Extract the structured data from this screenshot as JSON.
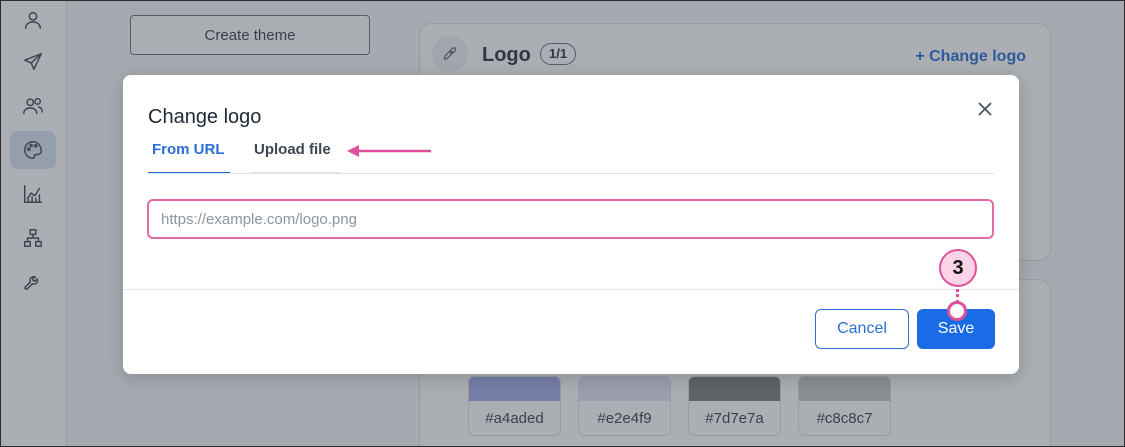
{
  "background": {
    "create_theme_label": "Create theme",
    "logo_card": {
      "title": "Logo",
      "count": "1/1",
      "change_logo_label": "+ Change logo"
    },
    "swatches": [
      {
        "hex": "#a4aded",
        "color": "#a4aded"
      },
      {
        "hex": "#e2e4f9",
        "color": "#e2e4f9"
      },
      {
        "hex": "#7d7e7a",
        "color": "#7d7e7a"
      },
      {
        "hex": "#c8c8c7",
        "color": "#c8c8c7"
      }
    ]
  },
  "sidebar": {
    "items": [
      {
        "icon": "user-icon"
      },
      {
        "icon": "send-icon"
      },
      {
        "icon": "contacts-icon"
      },
      {
        "icon": "palette-icon",
        "active": true
      },
      {
        "icon": "reports-chart-icon"
      },
      {
        "icon": "org-chart-icon"
      },
      {
        "icon": "wrench-icon"
      }
    ]
  },
  "modal": {
    "title": "Change logo",
    "tabs": [
      {
        "label": "From URL",
        "active": true
      },
      {
        "label": "Upload file",
        "active": false
      }
    ],
    "url_input": {
      "value": "",
      "placeholder": "https://example.com/logo.png"
    },
    "cancel_label": "Cancel",
    "save_label": "Save"
  },
  "callout": {
    "step_number": "3"
  },
  "colors": {
    "accent": "#1a6be6",
    "link": "#2a6fd4",
    "annotation_pink": "#e0509a"
  }
}
